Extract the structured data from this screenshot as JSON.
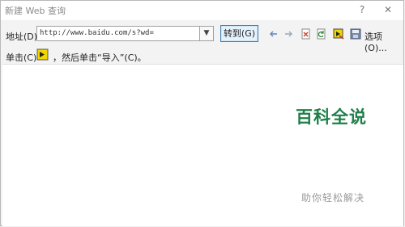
{
  "window": {
    "title": "新建 Web 查询",
    "help_glyph": "?",
    "close_glyph": "✕"
  },
  "toolbar": {
    "address_label": "地址(D):",
    "address_value": "http://www.baidu.com/s?wd=",
    "go_label": "转到(G)",
    "options_label": "选项(O)..."
  },
  "hint": {
    "prefix": "单击(C)",
    "suffix": "，然后单击“导入”(C)。"
  },
  "watermark": {
    "main": "百科全说",
    "sub": "助你轻松解决"
  },
  "colors": {
    "accent": "#3c7fb1",
    "watermark_green": "#1f7f4a",
    "arrow_yellow": "#f2d600"
  }
}
